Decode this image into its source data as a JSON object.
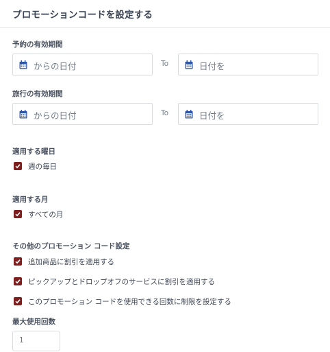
{
  "header": {
    "title": "プロモーションコードを設定する"
  },
  "booking_period": {
    "label": "予約の有効期間",
    "from_placeholder": "からの日付",
    "to_text": "To",
    "to_placeholder": "日付を"
  },
  "travel_period": {
    "label": "旅行の有効期間",
    "from_placeholder": "からの日付",
    "to_text": "To",
    "to_placeholder": "日付を"
  },
  "weekdays": {
    "label": "適用する曜日",
    "checkbox": {
      "label": "週の毎日",
      "checked": true
    }
  },
  "months": {
    "label": "適用する月",
    "checkbox": {
      "label": "すべての月",
      "checked": true
    }
  },
  "other": {
    "label": "その他のプロモーション コード設定",
    "options": [
      {
        "label": "追加商品に割引を適用する",
        "checked": true
      },
      {
        "label": "ピックアップとドロップオフのサービスに割引を適用する",
        "checked": true
      },
      {
        "label": "このプロモーション コードを使用できる回数に制限を設定する",
        "checked": true
      }
    ]
  },
  "max_uses": {
    "label": "最大使用回数",
    "value": "1"
  },
  "colors": {
    "checkbox": "#7d1f1f",
    "calendar_icon": "#2f56a6"
  }
}
